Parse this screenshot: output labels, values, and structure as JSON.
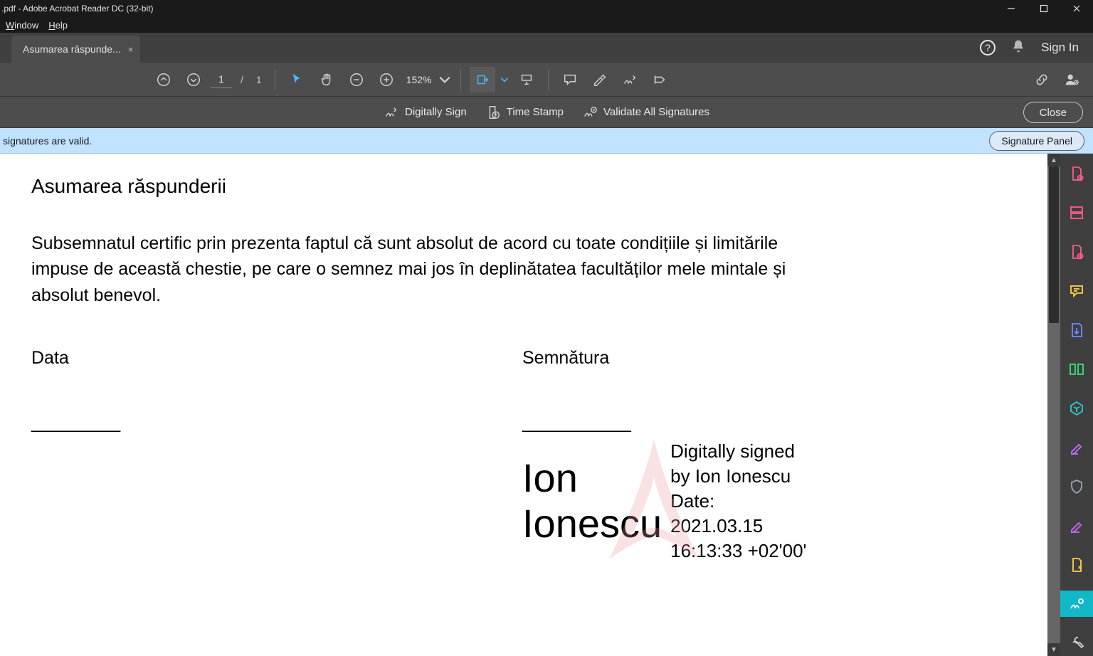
{
  "titlebar": {
    "title": ".pdf - Adobe Acrobat Reader DC (32-bit)"
  },
  "menubar": {
    "window": "Window",
    "help": "Help"
  },
  "tab": {
    "label": "Asumarea răspunde...",
    "close": "×"
  },
  "header_right": {
    "signin": "Sign In"
  },
  "toolbar": {
    "page_current": "1",
    "page_sep": "/",
    "page_total": "1",
    "zoom": "152%"
  },
  "toolbar2": {
    "digitally_sign": "Digitally Sign",
    "time_stamp": "Time Stamp",
    "validate_all": "Validate All Signatures",
    "close": "Close"
  },
  "sig_banner": {
    "msg": "signatures are valid.",
    "panel_btn": "Signature Panel"
  },
  "document": {
    "title": "Asumarea răspunderii",
    "body": "Subsemnatul certific prin prezenta faptul că sunt absolut de acord cu toate condițiile și limitările impuse de această chestie, pe care o semnez mai jos în deplinătatea facultăților mele mintale și absolut benevol.",
    "data_label": "Data",
    "semnatura_label": "Semnătura",
    "underline_left": "_________",
    "underline_right": "___________",
    "signature": {
      "name_line1": "Ion",
      "name_line2": "Ionescu",
      "details_line1": "Digitally signed",
      "details_line2": "by Ion Ionescu",
      "details_line3": "Date:",
      "details_line4": "2021.03.15",
      "details_line5": "16:13:33 +02'00'"
    }
  }
}
